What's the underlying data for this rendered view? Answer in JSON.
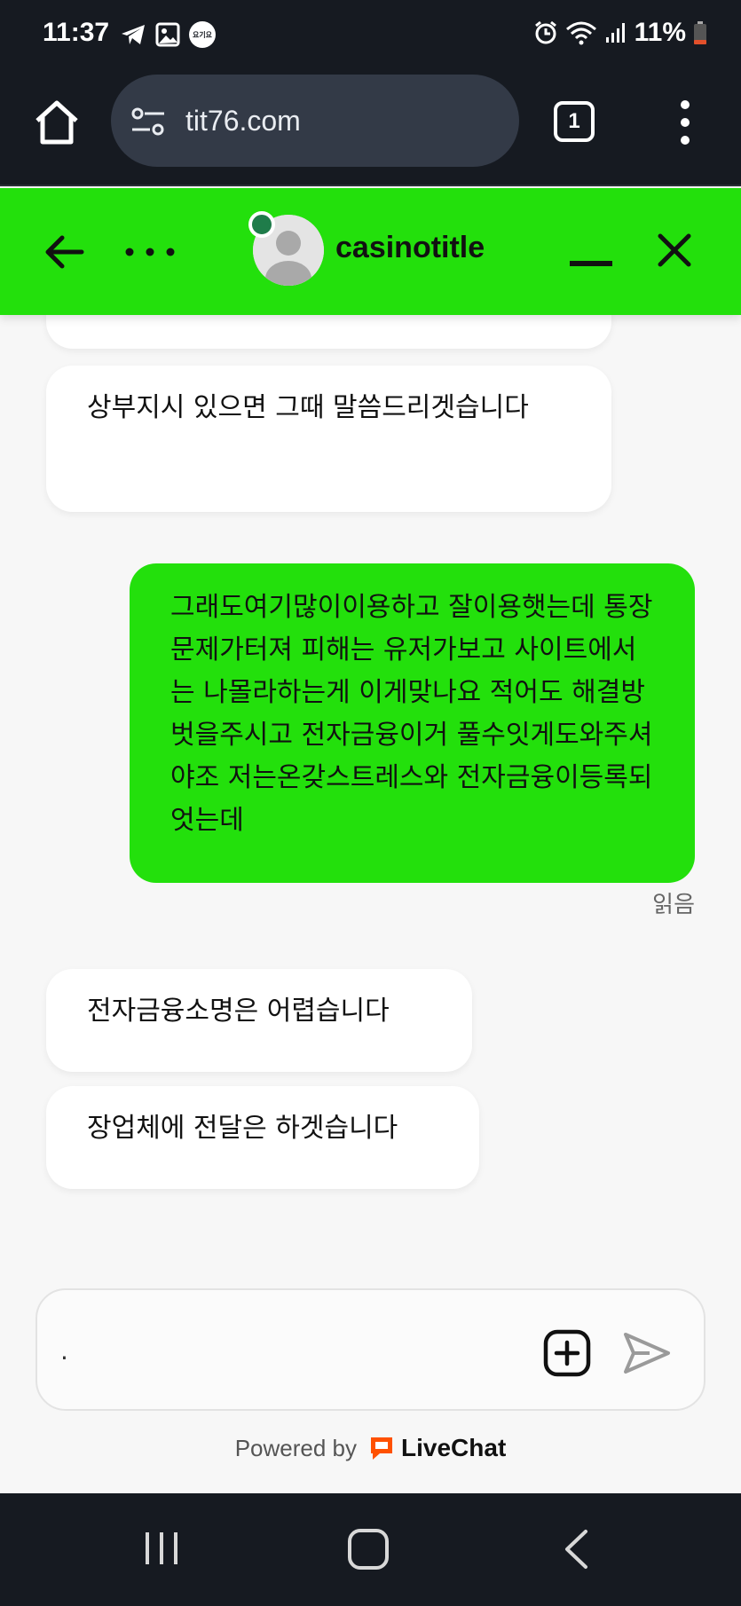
{
  "status_bar": {
    "time": "11:37",
    "battery": "11%",
    "left_icons": [
      "telegram-icon",
      "gallery-icon",
      "yogiyo-badge-icon"
    ],
    "right_icons": [
      "alarm-icon",
      "wifi-icon",
      "signal-icon",
      "battery-icon"
    ],
    "badge_text": "요기요"
  },
  "browser": {
    "url": "tit76.com",
    "tab_count": "1"
  },
  "chat_header": {
    "agent_name": "casinotitle",
    "online_color": "#1f7c4a",
    "accent_color": "#23e00c"
  },
  "messages": [
    {
      "author": "agent",
      "text": ""
    },
    {
      "author": "agent",
      "text": "상부지시 있으면 그때 말씀드리겟습니다"
    },
    {
      "author": "user",
      "text": "그래도여기많이이용하고 잘이용햇는데 통장문제가터져 피해는 유저가보고 사이트에서는 나몰라하는게 이게맞나요 적어도 해결방벗을주시고 전자금융이거 풀수잇게도와주셔야조 저는온갖스트레스와 전자금융이등록되엇는데",
      "status": "읽음"
    },
    {
      "author": "agent",
      "text": "전자금융소명은 어렵습니다"
    },
    {
      "author": "agent",
      "text": "장업체에 전달은 하겟습니다"
    }
  ],
  "composer": {
    "value": ".",
    "placeholder": ""
  },
  "footer": {
    "powered_by": "Powered by",
    "brand": "LiveChat"
  }
}
